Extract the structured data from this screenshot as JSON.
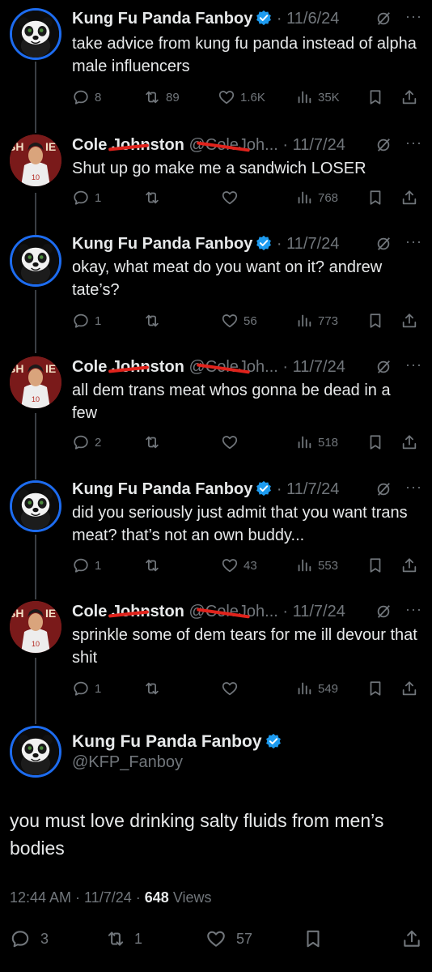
{
  "author_kfp": {
    "name": "Kung Fu Panda Fanboy",
    "handle": "@KFP_Fanboy"
  },
  "author_cole": {
    "name": "Cole Johnston",
    "handle": "@ColeJoh..."
  },
  "colors": {
    "background": "#000000",
    "muted": "#71767b",
    "accent_blue": "#1d9bf0",
    "redaction_red": "#e0231c"
  },
  "tweets": [
    {
      "author": "Kung Fu Panda Fanboy",
      "date": "· 11/6/24",
      "text": "take advice from kung fu panda instead of alpha male influencers",
      "replies": "8",
      "reposts": "89",
      "likes": "1.6K",
      "views": "35K"
    },
    {
      "author": "Cole Johnston",
      "handle": "@ColeJoh...",
      "date": "· 11/7/24",
      "text": "Shut up go make me a sandwich LOSER",
      "replies": "1",
      "reposts": "",
      "likes": "",
      "views": "768"
    },
    {
      "author": "Kung Fu Panda Fanboy",
      "date": "· 11/7/24",
      "text": "okay, what meat do you want on it? andrew tate’s?",
      "replies": "1",
      "reposts": "",
      "likes": "56",
      "views": "773"
    },
    {
      "author": "Cole Johnston",
      "handle": "@ColeJoh...",
      "date": "· 11/7/24",
      "text": "all dem trans meat whos gonna be dead in a few",
      "replies": "2",
      "reposts": "",
      "likes": "",
      "views": "518"
    },
    {
      "author": "Kung Fu Panda Fanboy",
      "date": "· 11/7/24",
      "text": "did you seriously just admit that you want trans meat? that’s not an own buddy...",
      "replies": "1",
      "reposts": "",
      "likes": "43",
      "views": "553"
    },
    {
      "author": "Cole Johnston",
      "handle": "@ColeJoh...",
      "date": "· 11/7/24",
      "text": "sprinkle some of dem tears for me ill devour that shit",
      "replies": "1",
      "reposts": "",
      "likes": "",
      "views": "549"
    }
  ],
  "main_tweet": {
    "author": "Kung Fu Panda Fanboy",
    "handle": "@KFP_Fanboy",
    "text": "you must love drinking salty fluids from men’s bodies",
    "time_date": "12:44 AM · 11/7/24 · ",
    "views_count": "648",
    "views_label": " Views",
    "replies": "3",
    "reposts": "1",
    "likes": "57"
  }
}
